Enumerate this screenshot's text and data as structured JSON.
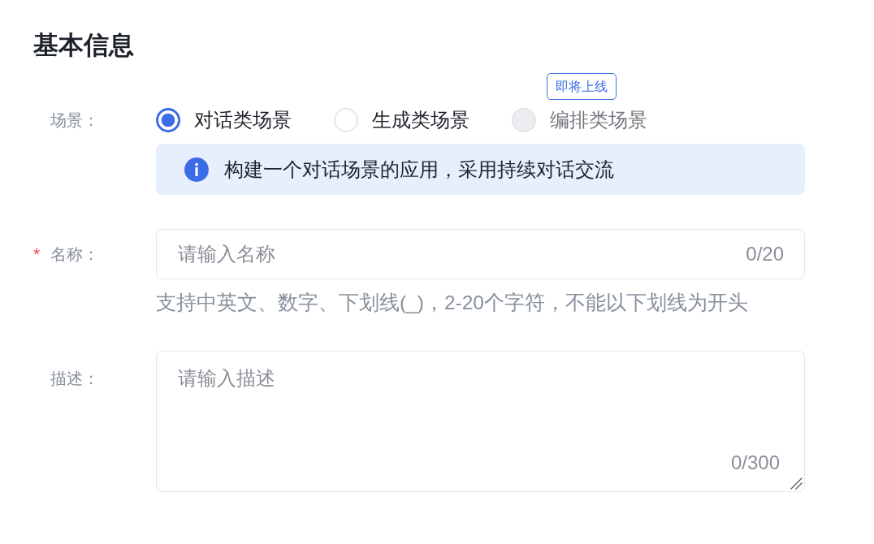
{
  "section_title": "基本信息",
  "fields": [
    {
      "kind": "radio",
      "label": "场景：",
      "options": [
        {
          "label": "对话类场景",
          "selected": true,
          "disabled": false
        },
        {
          "label": "生成类场景",
          "selected": false,
          "disabled": false
        },
        {
          "label": "编排类场景",
          "selected": false,
          "disabled": true,
          "badge": "即将上线"
        }
      ],
      "info": "构建一个对话场景的应用，采用持续对话交流"
    },
    {
      "kind": "input",
      "required_mark": "*",
      "label": "名称：",
      "placeholder": "请输入名称",
      "counter": "0/20",
      "help": "支持中英文、数字、下划线(_)，2-20个字符，不能以下划线为开头"
    },
    {
      "kind": "textarea",
      "label": "描述：",
      "placeholder": "请输入描述",
      "counter": "0/300"
    }
  ]
}
